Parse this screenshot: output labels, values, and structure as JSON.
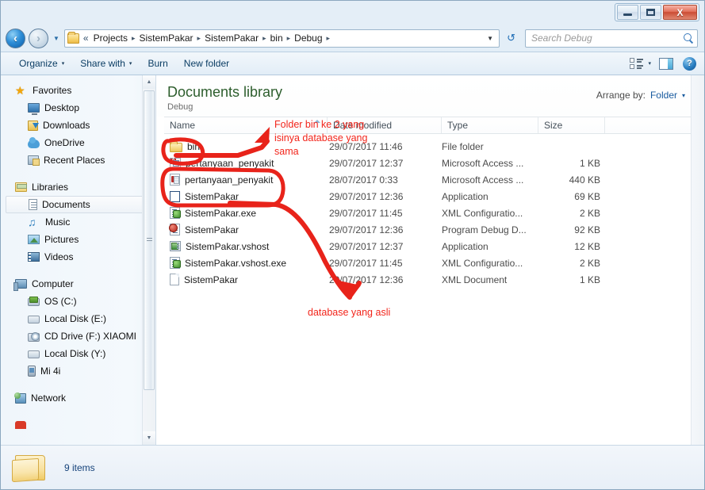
{
  "window": {
    "controls": {
      "minimize": "Minimize",
      "maximize": "Maximize",
      "close": "X"
    }
  },
  "address": {
    "back_label": "‹",
    "forward_label": "›",
    "history_caret": "▼",
    "double_chevron": "«",
    "crumbs": [
      "Projects",
      "SistemPakar",
      "SistemPakar",
      "bin",
      "Debug"
    ],
    "separator": "▸",
    "dropdown_caret": "▼",
    "refresh_label": "↺"
  },
  "search": {
    "placeholder": "Search Debug"
  },
  "toolbar": {
    "organize": "Organize",
    "share_with": "Share with",
    "burn": "Burn",
    "new_folder": "New folder",
    "caret": "▾",
    "help": "?"
  },
  "navpane": {
    "groups": [
      {
        "header": {
          "label": "Favorites",
          "icon": "star-icon"
        },
        "items": [
          {
            "label": "Desktop",
            "icon": "desktop-icon"
          },
          {
            "label": "Downloads",
            "icon": "downloads-icon"
          },
          {
            "label": "OneDrive",
            "icon": "cloud-icon"
          },
          {
            "label": "Recent Places",
            "icon": "recent-places-icon"
          }
        ]
      },
      {
        "header": {
          "label": "Libraries",
          "icon": "libraries-icon"
        },
        "items": [
          {
            "label": "Documents",
            "icon": "document-icon",
            "selected": true
          },
          {
            "label": "Music",
            "icon": "music-icon"
          },
          {
            "label": "Pictures",
            "icon": "pictures-icon"
          },
          {
            "label": "Videos",
            "icon": "videos-icon"
          }
        ]
      },
      {
        "header": {
          "label": "Computer",
          "icon": "computer-icon"
        },
        "items": [
          {
            "label": "OS (C:)",
            "icon": "harddisk-icon"
          },
          {
            "label": "Local Disk (E:)",
            "icon": "disk-icon"
          },
          {
            "label": "CD Drive (F:) XIAOMI",
            "icon": "cd-drive-icon"
          },
          {
            "label": "Local Disk (Y:)",
            "icon": "disk-icon"
          },
          {
            "label": "Mi 4i",
            "icon": "phone-icon"
          }
        ]
      },
      {
        "header": {
          "label": "Network",
          "icon": "network-icon"
        },
        "items": []
      }
    ]
  },
  "library": {
    "title": "Documents library",
    "subtitle": "Debug",
    "arrange_label": "Arrange by:",
    "arrange_value": "Folder",
    "arrange_caret": "▾"
  },
  "columns": [
    {
      "key": "name",
      "label": "Name",
      "sorted": true
    },
    {
      "key": "date",
      "label": "Date modified"
    },
    {
      "key": "type",
      "label": "Type"
    },
    {
      "key": "size",
      "label": "Size"
    }
  ],
  "files": [
    {
      "name": "bin",
      "date": "29/07/2017 11:46",
      "type": "File folder",
      "size": "",
      "icon": "folder-icon"
    },
    {
      "name": "pertanyaan_penyakit",
      "date": "29/07/2017 12:37",
      "type": "Microsoft Access ...",
      "size": "1 KB",
      "icon": "access-shortcut-icon"
    },
    {
      "name": "pertanyaan_penyakit",
      "date": "28/07/2017 0:33",
      "type": "Microsoft Access ...",
      "size": "440 KB",
      "icon": "access-db-icon"
    },
    {
      "name": "SistemPakar",
      "date": "29/07/2017 12:36",
      "type": "Application",
      "size": "69 KB",
      "icon": "application-blank-icon"
    },
    {
      "name": "SistemPakar.exe",
      "date": "29/07/2017 11:45",
      "type": "XML Configuratio...",
      "size": "2 KB",
      "icon": "xml-config-icon"
    },
    {
      "name": "SistemPakar",
      "date": "29/07/2017 12:36",
      "type": "Program Debug D...",
      "size": "92 KB",
      "icon": "program-debug-icon"
    },
    {
      "name": "SistemPakar.vshost",
      "date": "29/07/2017 12:37",
      "type": "Application",
      "size": "12 KB",
      "icon": "executable-icon"
    },
    {
      "name": "SistemPakar.vshost.exe",
      "date": "29/07/2017 11:45",
      "type": "XML Configuratio...",
      "size": "2 KB",
      "icon": "xml-config-icon"
    },
    {
      "name": "SistemPakar",
      "date": "29/07/2017 12:36",
      "type": "XML Document",
      "size": "1 KB",
      "icon": "xml-document-icon"
    }
  ],
  "status": {
    "items_count": "9 items"
  },
  "annotations": {
    "color": "#f2251b",
    "note_top": "Folder bin ke 2 yang\nisinya database yang\nsama",
    "note_bottom": "database yang asli"
  }
}
